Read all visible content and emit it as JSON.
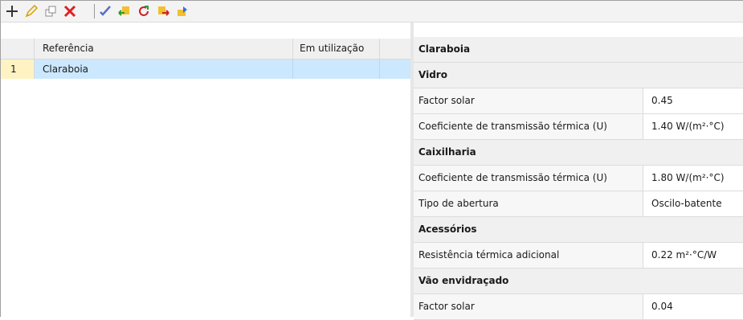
{
  "toolbar": {
    "icons": [
      "add-icon",
      "edit-icon",
      "copy-icon",
      "delete-icon",
      "apply-icon",
      "import-icon",
      "refresh-icon",
      "export-icon",
      "library-icon"
    ]
  },
  "table": {
    "columns": [
      "Referência",
      "Em utilização"
    ],
    "rows": [
      {
        "num": "1",
        "reference": "Claraboia",
        "in_use": ""
      }
    ]
  },
  "properties": {
    "title": "Claraboia",
    "sections": [
      {
        "label": "Vidro",
        "rows": [
          {
            "key": "Factor solar",
            "value": "0.45"
          },
          {
            "key": "Coeficiente de transmissão térmica (U)",
            "value": "1.40 W/(m²·°C)"
          }
        ]
      },
      {
        "label": "Caixilharia",
        "rows": [
          {
            "key": "Coeficiente de transmissão térmica (U)",
            "value": "1.80 W/(m²·°C)"
          },
          {
            "key": "Tipo de abertura",
            "value": "Oscilo-batente"
          }
        ]
      },
      {
        "label": "Acessórios",
        "rows": [
          {
            "key": "Resistência térmica adicional",
            "value": "0.22 m²·°C/W"
          }
        ]
      },
      {
        "label": "Vão envidraçado",
        "rows": [
          {
            "key": "Factor solar",
            "value": "0.04"
          }
        ]
      }
    ]
  }
}
